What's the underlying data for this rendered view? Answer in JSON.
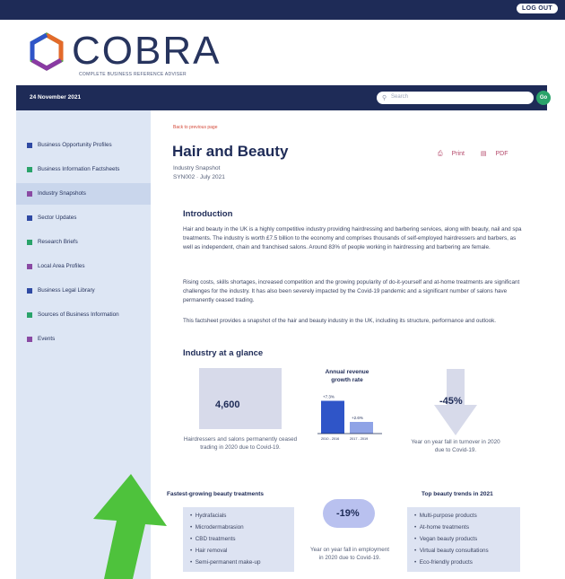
{
  "header": {
    "logout_label": "LOG OUT"
  },
  "logo": {
    "wordmark": "COBRA",
    "tagline": "COMPLETE BUSINESS REFERENCE ADVISER"
  },
  "navbar": {
    "date": "24 November 2021",
    "search_placeholder": "Search",
    "go_label": "Go"
  },
  "sidebar": {
    "items": [
      {
        "label": "Business Opportunity Profiles",
        "color": "#2f4aa3"
      },
      {
        "label": "Business Information Factsheets",
        "color": "#2aa36a"
      },
      {
        "label": "Industry Snapshots",
        "color": "#8a4aa3",
        "active": true
      },
      {
        "label": "Sector Updates",
        "color": "#2f4aa3"
      },
      {
        "label": "Research Briefs",
        "color": "#2aa36a"
      },
      {
        "label": "Local Area Profiles",
        "color": "#8a4aa3"
      },
      {
        "label": "Business Legal Library",
        "color": "#2f4aa3"
      },
      {
        "label": "Sources of Business Information",
        "color": "#2aa36a"
      },
      {
        "label": "Events",
        "color": "#8a4aa3"
      }
    ]
  },
  "main": {
    "back_link": "Back to previous page",
    "title": "Hair and Beauty",
    "print_label": "Print",
    "pdf_label": "PDF",
    "subtitle": "Industry Snapshot",
    "ref": "SYN002 · July 2021",
    "intro_heading": "Introduction",
    "intro_para1": "Hair and beauty in the UK is a highly competitive industry providing hairdressing and barbering services, along with beauty, nail and spa treatments. The industry is worth £7.5 billion to the economy and comprises thousands of self-employed hairdressers and barbers, as well as independent, chain and franchised salons. Around 83% of people working in hairdressing and barbering are female.",
    "intro_para2": "Rising costs, skills shortages, increased competition and the growing popularity of do-it-yourself and at-home treatments are significant challenges for the industry. It has also been severely impacted by the Covid-19 pandemic and a significant number of salons have permanently ceased trading.",
    "intro_para3": "This factsheet provides a snapshot of the hair and beauty industry in the UK, including its structure, performance and outlook.",
    "glance_heading": "Industry at a glance",
    "stat_salons": {
      "value": "4,600",
      "caption": "Hairdressers and salons permanently ceased trading in 2020 due to Covid-19."
    },
    "stat_turnover": {
      "value": "-45%",
      "caption": "Year on year fall in turnover in 2020 due to Covid-19."
    },
    "stat_employment": {
      "value": "-19%",
      "caption": "Year on year fall in employment in 2020 due to Covid-19."
    },
    "fastest_heading": "Fastest-growing beauty treatments",
    "fastest_items": [
      "Hydrafacials",
      "Microdermabrasion",
      "CBD treatments",
      "Hair removal",
      "Semi-permanent make-up"
    ],
    "trends_heading": "Top beauty trends in 2021",
    "trends_items": [
      "Multi-purpose products",
      "At-home treatments",
      "Vegan beauty products",
      "Virtual beauty consultations",
      "Eco-friendly products"
    ]
  },
  "chart_data": {
    "type": "bar",
    "title": "Annual revenue growth rate",
    "categories": [
      "2010 - 2016",
      "2017 - 2019"
    ],
    "values": [
      7.3,
      2.6
    ],
    "data_labels": [
      "+7.3%",
      "+2.6%"
    ],
    "ylim": [
      0,
      8
    ],
    "colors": [
      "#2f55c8",
      "#8fa3e6"
    ]
  }
}
